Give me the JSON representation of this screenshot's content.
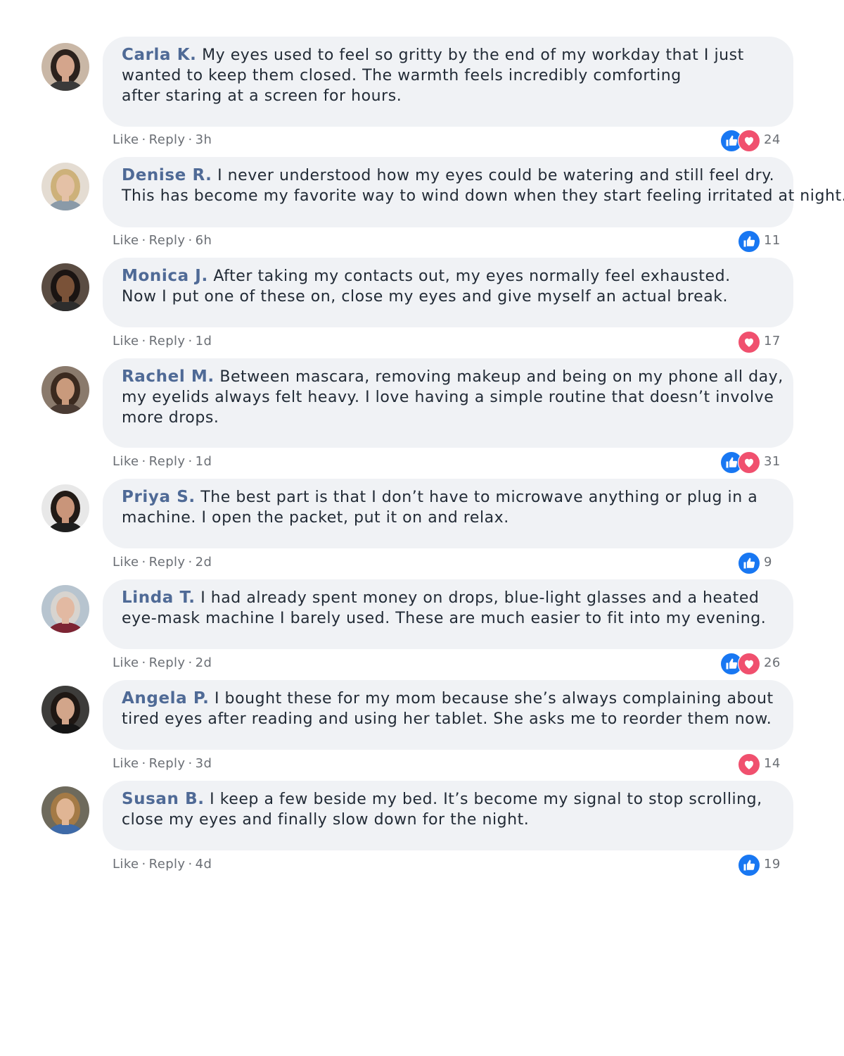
{
  "meta_labels": {
    "like": "Like",
    "reply": "Reply",
    "separator": "·"
  },
  "colors": {
    "bubble_bg": "#f0f2f5",
    "author": "#4f6a96",
    "like_blue": "#1877f2",
    "love_red": "#f0506e",
    "meta_gray": "#6b6f75"
  },
  "comments": [
    {
      "author": "Carla K.",
      "lines": [
        "My eyes used to feel so gritty by the end of my workday that I just",
        "wanted to keep them closed. The warmth feels incredibly comforting",
        "after staring at a screen for hours."
      ],
      "time": "3h",
      "reactions": [
        "like-icon",
        "heart-icon"
      ],
      "count": "24"
    },
    {
      "author": "Denise R.",
      "lines": [
        "I never understood how my eyes could be watering and still feel dry.",
        "This has become my favorite way to wind down when they start feeling irritated at night."
      ],
      "time": "6h",
      "reactions": [
        "like-icon"
      ],
      "count": "11"
    },
    {
      "author": "Monica J.",
      "lines": [
        "After taking my contacts out, my eyes normally feel exhausted.",
        "Now I put one of these on, close my eyes and give myself an actual break."
      ],
      "time": "1d",
      "reactions": [
        "heart-icon"
      ],
      "count": "17"
    },
    {
      "author": "Rachel M.",
      "lines": [
        "Between mascara, removing makeup and being on my phone all day,",
        "my eyelids always felt heavy. I love having a simple routine that doesn’t involve",
        "more drops."
      ],
      "time": "1d",
      "reactions": [
        "like-icon",
        "heart-icon"
      ],
      "count": "31"
    },
    {
      "author": "Priya S.",
      "lines": [
        "The best part is that I don’t have to microwave anything or plug in a",
        "machine. I open the packet, put it on and relax."
      ],
      "time": "2d",
      "reactions": [
        "like-icon"
      ],
      "count": "9"
    },
    {
      "author": "Linda T.",
      "lines": [
        "I had already spent money on drops, blue-light glasses and a heated",
        "eye-mask machine I barely used. These are much easier to fit into my evening."
      ],
      "time": "2d",
      "reactions": [
        "like-icon",
        "heart-icon"
      ],
      "count": "26"
    },
    {
      "author": "Angela P.",
      "lines": [
        "I bought these for my mom because she’s always complaining about",
        "tired eyes after reading and using her tablet. She asks me to reorder them now."
      ],
      "time": "3d",
      "reactions": [
        "heart-icon"
      ],
      "count": "14"
    },
    {
      "author": "Susan B.",
      "lines": [
        "I keep a few beside my bed. It’s become my signal to stop scrolling,",
        "close my eyes and finally slow down for the night."
      ],
      "time": "4d",
      "reactions": [
        "like-icon"
      ],
      "count": "19"
    }
  ]
}
